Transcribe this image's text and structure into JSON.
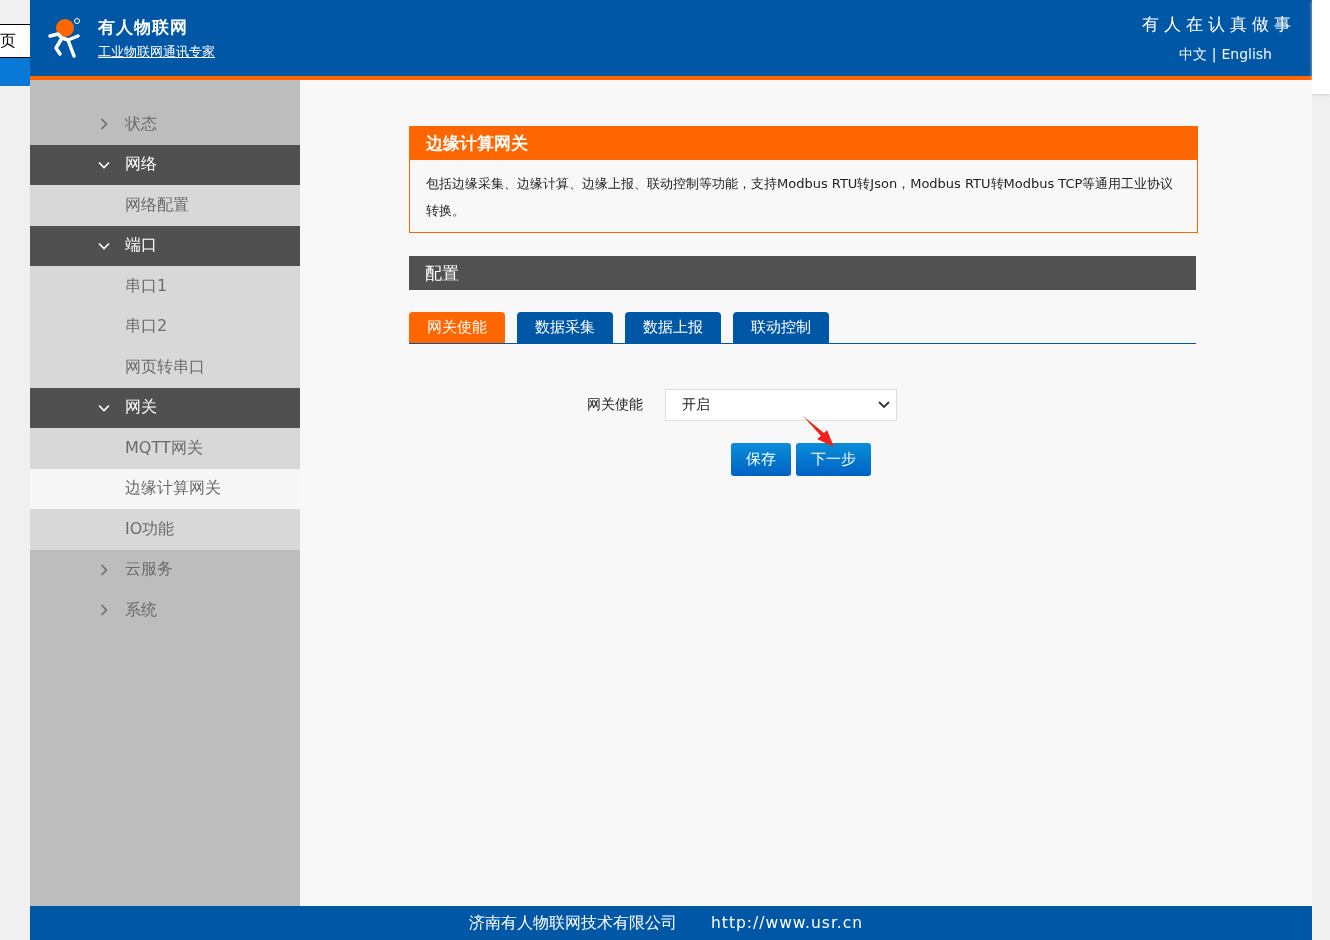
{
  "background_window": {
    "text": "页"
  },
  "header": {
    "brand": "有人物联网",
    "tagline": "工业物联网通讯专家",
    "slogan": "有人在认真做事",
    "languages": [
      "中文",
      "English"
    ],
    "language_separator": "|"
  },
  "sidebar": {
    "items": [
      {
        "label": "状态",
        "expanded": false
      },
      {
        "label": "网络",
        "expanded": true,
        "children": [
          {
            "label": "网络配置",
            "selected": false
          }
        ]
      },
      {
        "label": "端口",
        "expanded": true,
        "children": [
          {
            "label": "串口1",
            "selected": false
          },
          {
            "label": "串口2",
            "selected": false
          },
          {
            "label": "网页转串口",
            "selected": false
          }
        ]
      },
      {
        "label": "网关",
        "expanded": true,
        "children": [
          {
            "label": "MQTT网关",
            "selected": false
          },
          {
            "label": "边缘计算网关",
            "selected": true
          },
          {
            "label": "IO功能",
            "selected": false
          }
        ]
      },
      {
        "label": "云服务",
        "expanded": false
      },
      {
        "label": "系统",
        "expanded": false
      }
    ]
  },
  "intro": {
    "title": "边缘计算网关",
    "text": "包括边缘采集、边缘计算、边缘上报、联动控制等功能，支持Modbus RTU转Json，Modbus RTU转Modbus TCP等通用工业协议转换。"
  },
  "config": {
    "title": "配置",
    "tabs": [
      {
        "label": "网关使能",
        "selected": true
      },
      {
        "label": "数据采集",
        "selected": false
      },
      {
        "label": "数据上报",
        "selected": false
      },
      {
        "label": "联动控制",
        "selected": false
      }
    ],
    "field": {
      "label": "网关使能",
      "value": "开启"
    },
    "buttons": [
      "保存",
      "下一步"
    ]
  },
  "footer": {
    "company": "济南有人物联网技术有限公司",
    "url": "http://www.usr.cn"
  }
}
